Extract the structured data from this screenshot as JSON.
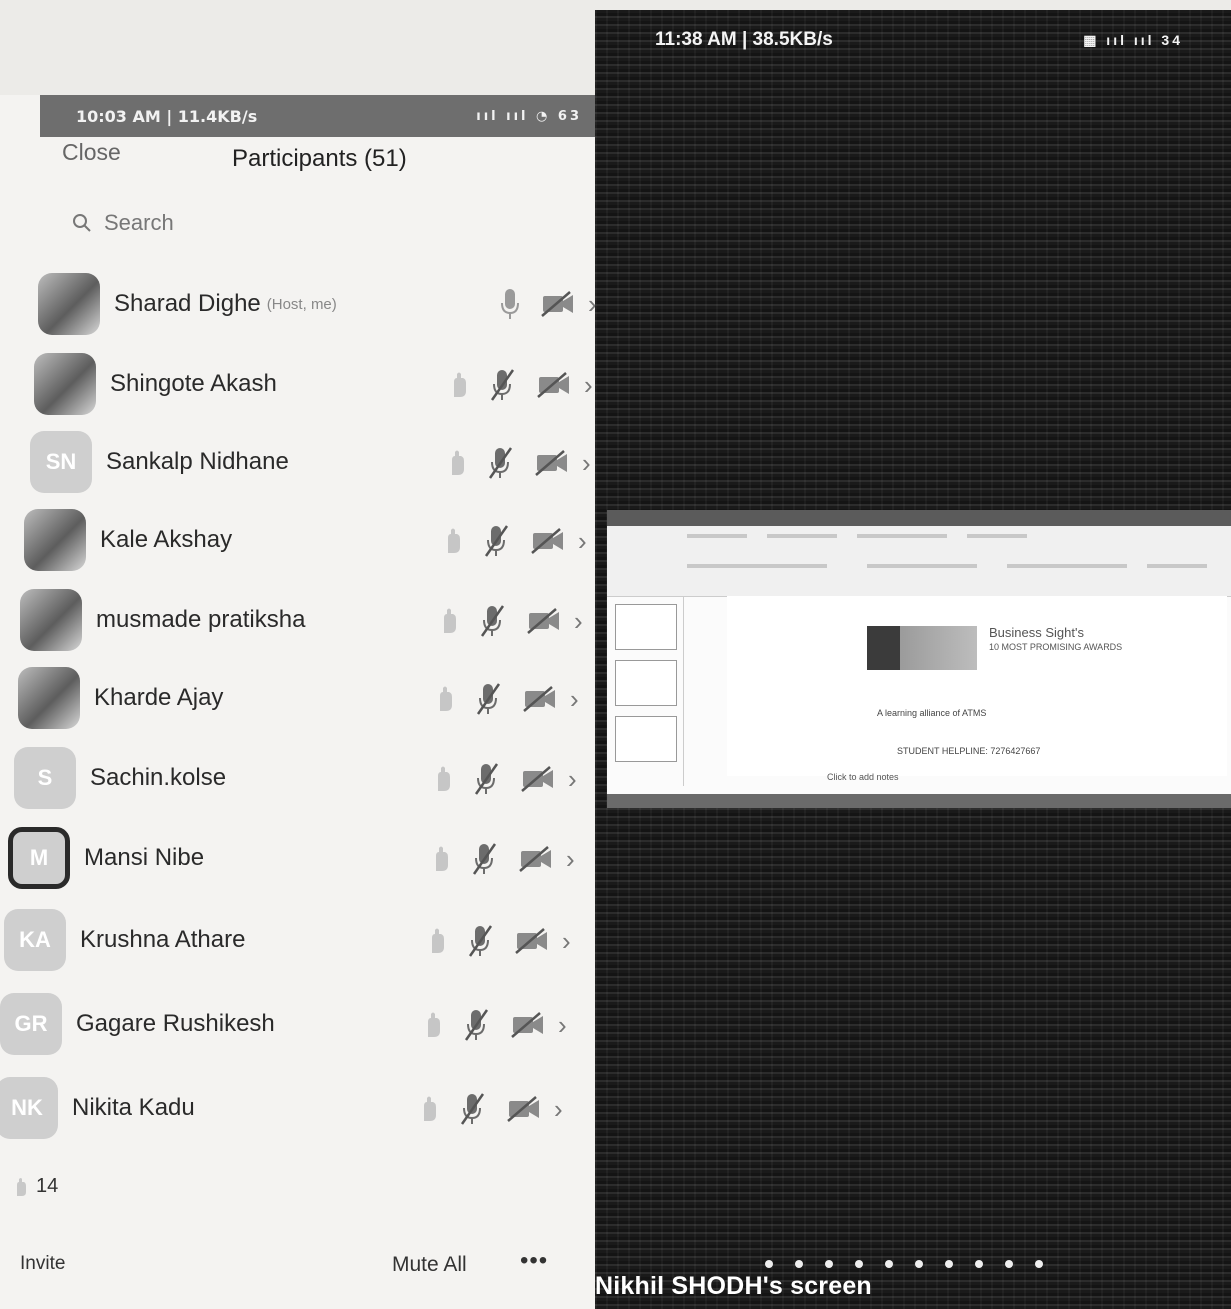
{
  "left_status": {
    "time": "10:03 AM | 11.4KB/s",
    "icons": "ııl ııl ◔ 63"
  },
  "header": {
    "close_label": "Close",
    "title": "Participants (51)"
  },
  "search": {
    "placeholder": "Search"
  },
  "participants": [
    {
      "name": "Sharad Dighe",
      "tag": "(Host, me)",
      "initials": "",
      "avatar": "photo"
    },
    {
      "name": "Shingote Akash",
      "tag": "",
      "initials": "",
      "avatar": "photo"
    },
    {
      "name": "Sankalp Nidhane",
      "tag": "",
      "initials": "SN",
      "avatar": "initials"
    },
    {
      "name": "Kale Akshay",
      "tag": "",
      "initials": "",
      "avatar": "photo"
    },
    {
      "name": "musmade pratiksha",
      "tag": "",
      "initials": "",
      "avatar": "photo"
    },
    {
      "name": "Kharde Ajay",
      "tag": "",
      "initials": "",
      "avatar": "photo"
    },
    {
      "name": "Sachin.kolse",
      "tag": "",
      "initials": "S",
      "avatar": "initials"
    },
    {
      "name": "Mansi Nibe",
      "tag": "",
      "initials": "M",
      "avatar": "outline"
    },
    {
      "name": "Krushna Athare",
      "tag": "",
      "initials": "KA",
      "avatar": "initials"
    },
    {
      "name": "Gagare Rushikesh",
      "tag": "",
      "initials": "GR",
      "avatar": "initials"
    },
    {
      "name": "Nikita Kadu",
      "tag": "",
      "initials": "NK",
      "avatar": "initials"
    }
  ],
  "raised_hands": {
    "count": "14"
  },
  "bottom": {
    "invite_label": "Invite",
    "mute_all_label": "Mute All",
    "more_label": "•••"
  },
  "right_status": {
    "time": "11:38 AM | 38.5KB/s",
    "icons": "▦ ııl ııl 34"
  },
  "shared": {
    "slide_title": "Business Sight's",
    "slide_subtitle": "10 MOST PROMISING AWARDS",
    "slide_line1": "A learning alliance of ATMS",
    "slide_line2": "STUDENT HELPLINE: 7276427667",
    "notes": "Click to add notes"
  },
  "screen_label": "Nikhil SHODH's screen"
}
